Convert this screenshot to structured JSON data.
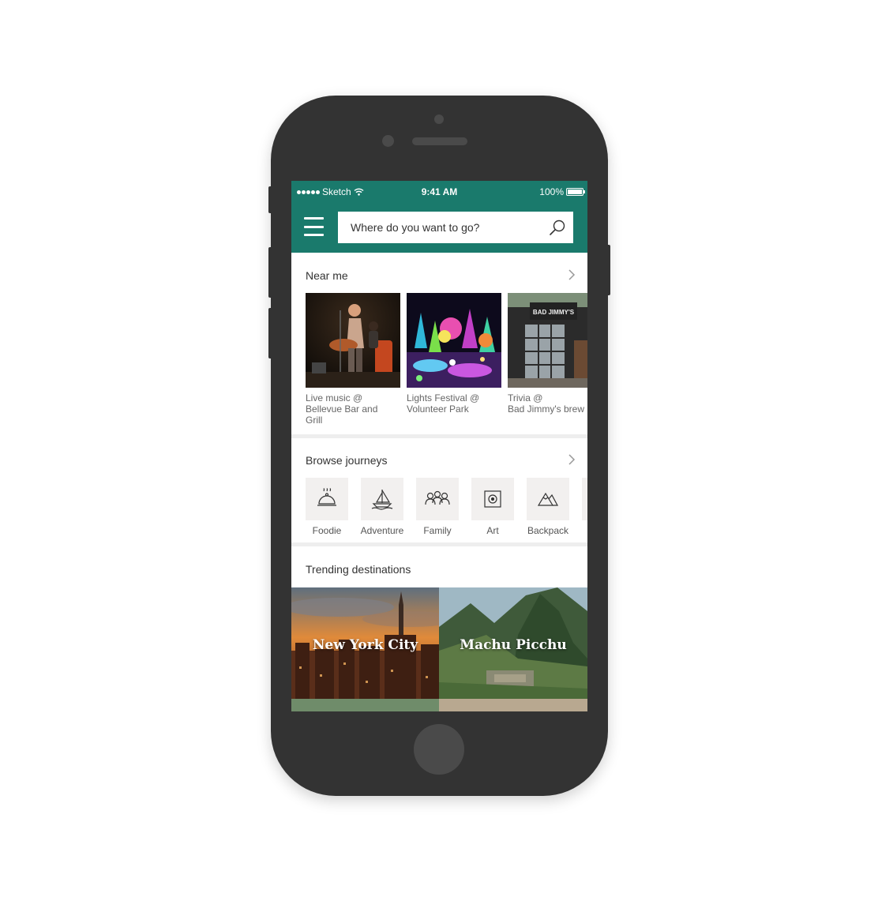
{
  "status_bar": {
    "carrier": "Sketch",
    "time": "9:41 AM",
    "battery": "100%"
  },
  "search": {
    "placeholder": "Where do you want to go?"
  },
  "near_me": {
    "title": "Near me",
    "items": [
      {
        "caption": "Live music @\nBellevue Bar and\nGrill"
      },
      {
        "caption": "Lights Festival @\nVolunteer Park"
      },
      {
        "caption": "Trivia @\nBad Jimmy's brew"
      }
    ],
    "sign_text": "BAD JIMMY'S"
  },
  "browse_journeys": {
    "title": "Browse journeys",
    "items": [
      {
        "label": "Foodie",
        "icon": "cloche-icon"
      },
      {
        "label": "Adventure",
        "icon": "sailboat-icon"
      },
      {
        "label": "Family",
        "icon": "family-icon"
      },
      {
        "label": "Art",
        "icon": "art-frame-icon"
      },
      {
        "label": "Backpack",
        "icon": "mountains-icon"
      }
    ]
  },
  "trending": {
    "title": "Trending destinations",
    "items": [
      {
        "label": "New York City"
      },
      {
        "label": "Machu Picchu"
      }
    ]
  },
  "colors": {
    "header": "#1a7a6c",
    "tile_bg": "#f2f0ef",
    "phone_body": "#333333"
  }
}
